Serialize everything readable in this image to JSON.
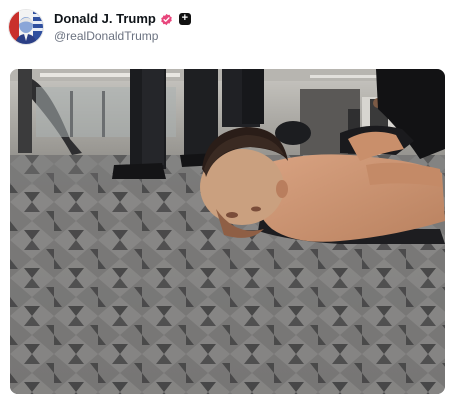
{
  "post": {
    "author": {
      "display_name": "Donald J. Trump",
      "handle": "@realDonaldTrump",
      "verified": true,
      "verified_color": "#e8467c",
      "avatar_icon": "profile-photo",
      "follow_icon": "plus-icon",
      "follow_glyph": "+"
    },
    "media": {
      "type": "photo",
      "subject": "person lying face-down on patterned carpet, hands held behind back"
    }
  },
  "colors": {
    "text_primary": "#0f1419",
    "text_secondary": "#6b7280",
    "badge_pink": "#e8467c",
    "follow_dark": "#111111"
  }
}
